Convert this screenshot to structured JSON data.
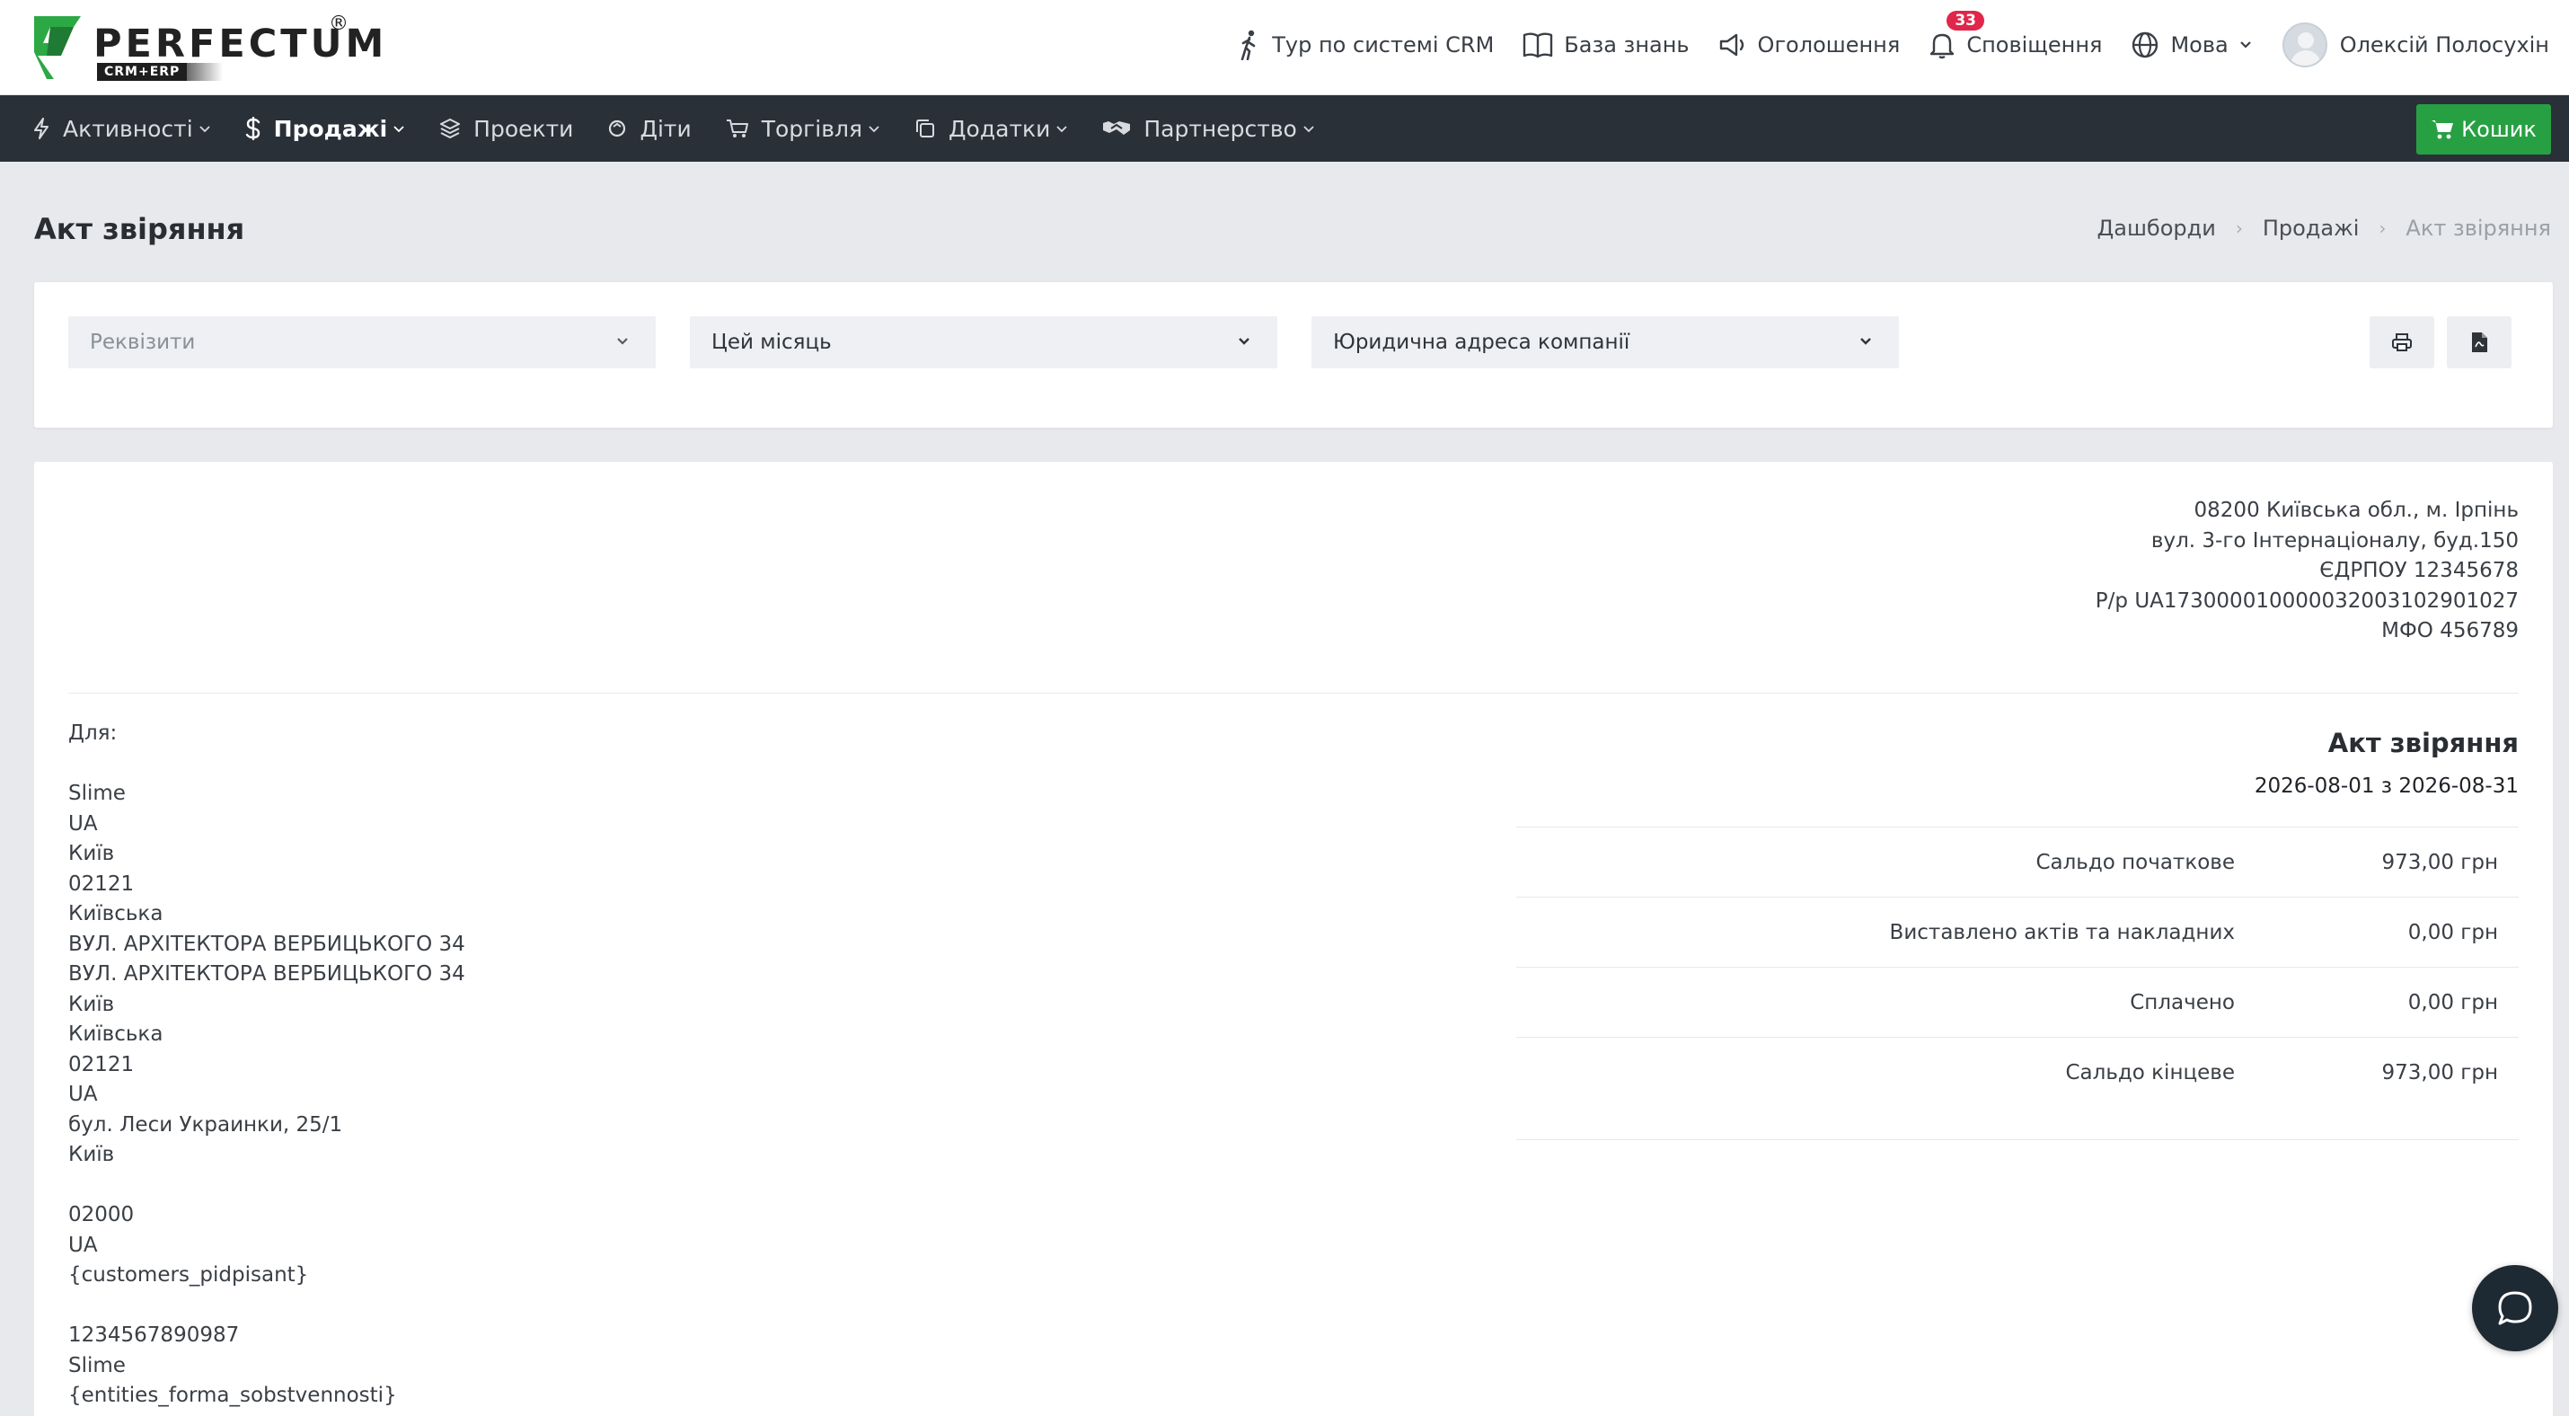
{
  "brand": {
    "name": "PERFECTUM",
    "tagline": "CRM+ERP",
    "registered": "®",
    "accent": "#2ca845"
  },
  "topnav": {
    "tour": "Тур по системі CRM",
    "knowledge": "База знань",
    "announcements": "Оголошення",
    "notifications": "Сповіщення",
    "notifications_count": "33",
    "language": "Мова",
    "user_name": "Олексій Полосухін"
  },
  "mainnav": {
    "items": [
      {
        "label": "Активності",
        "icon": "bolt-icon"
      },
      {
        "label": "Продажі",
        "icon": "dollar-icon"
      },
      {
        "label": "Проекти",
        "icon": "layers-icon"
      },
      {
        "label": "Діти",
        "icon": "circle-icon"
      },
      {
        "label": "Торгівля",
        "icon": "cart-icon"
      },
      {
        "label": "Додатки",
        "icon": "copy-icon"
      },
      {
        "label": "Партнерство",
        "icon": "handshake-icon"
      }
    ],
    "cart_label": "Кошик",
    "cart_color": "#27a043"
  },
  "page": {
    "title": "Акт звіряння",
    "breadcrumb": [
      "Дашборди",
      "Продажі",
      "Акт звіряння"
    ]
  },
  "filters": {
    "requisites_placeholder": "Реквізити",
    "period": "Цей місяць",
    "address": "Юридична адреса компанії"
  },
  "document": {
    "company_lines": [
      "08200 Київська обл., м. Ірпінь",
      "вул. 3-го Інтернаціоналу, буд.150",
      "ЄДРПОУ 12345678",
      "Р/р UA173000010000032003102901027",
      "МФО 456789"
    ],
    "for_label": "Для:",
    "client_lines_1": [
      "Slime",
      "UA",
      "Київ",
      "02121",
      "Київська",
      "ВУЛ. АРХІТЕКТОРА ВЕРБИЦЬКОГО 34",
      "ВУЛ. АРХІТЕКТОРА ВЕРБИЦЬКОГО 34",
      "Київ",
      "Київська",
      "02121",
      "UA",
      "бул. Леси Украинки, 25/1",
      "Київ"
    ],
    "client_lines_2": [
      "02000",
      "UA",
      "{customers_pidpisant}"
    ],
    "client_lines_3": [
      "1234567890987",
      "Slime",
      "{entities_forma_sobstvennosti}"
    ],
    "act_title": "Акт звіряння",
    "period": "2026-08-01 з 2026-08-31",
    "summary": [
      {
        "label": "Сальдо початкове",
        "value": "973,00 грн"
      },
      {
        "label": "Виставлено актів та накладних",
        "value": "0,00 грн"
      },
      {
        "label": "Сплачено",
        "value": "0,00 грн"
      },
      {
        "label": "Сальдо кінцеве",
        "value": "973,00 грн"
      }
    ]
  }
}
